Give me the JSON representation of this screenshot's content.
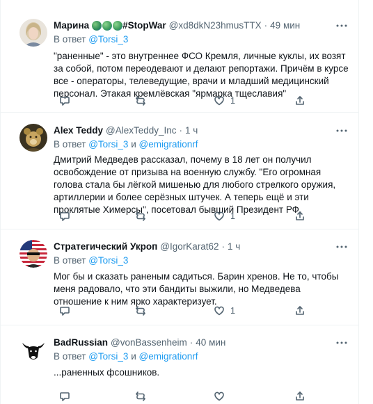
{
  "common": {
    "reply_prefix": "В ответ",
    "and": "и"
  },
  "tweets": [
    {
      "name": "Марина",
      "name_suffix": "#StopWar",
      "handle": "@xd8dkN23hmusTTX",
      "time": "49 мин",
      "reply_to": [
        "@Torsi_3"
      ],
      "text": "\"раненные\" - это внутреннее ФСО Кремля, личные куклы, их возят за собой, потом переодевают и делают репортажи. Причём в курсе все - операторы, телеведущие, врачи и младший медицинский персонал. Этакая кремлёвская \"ярмарка тщеславия\"",
      "like_count": "1"
    },
    {
      "name": "Alex Teddy",
      "handle": "@AlexTeddy_Inc",
      "time": "1 ч",
      "reply_to": [
        "@Torsi_3",
        "@emigrationrf"
      ],
      "text": "Дмитрий Медведев рассказал, почему в 18 лет он получил освобождение от призыва на военную службу. \"Его огромная голова стала бы лёгкой мишенью для любого стрелкого оружия, артиллерии и более серёзных штучек. А теперь ещё и эти проклятые Химерсы\", посетовал бывший Президент РФ.",
      "like_count": "1"
    },
    {
      "name": "Стратегический Укроп",
      "handle": "@IgorKarat62",
      "time": "1 ч",
      "reply_to": [
        "@Torsi_3"
      ],
      "text": "Мог бы и сказать раненым садиться. Барин хренов. Не то, чтобы меня радовало, что эти бандиты выжили, но Медведева отношение к ним ярко характеризует.",
      "like_count": "1"
    },
    {
      "name": "BadRussian",
      "handle": "@vonBassenheim",
      "time": "40 мин",
      "reply_to": [
        "@Torsi_3",
        "@emigrationrf"
      ],
      "text": "...раненных фсошников.",
      "like_count": ""
    }
  ]
}
